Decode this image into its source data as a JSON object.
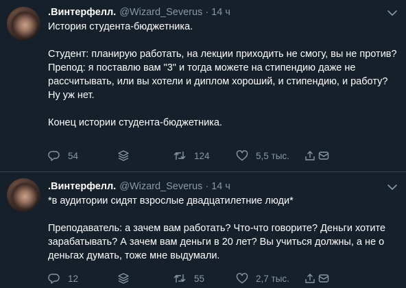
{
  "tweets": [
    {
      "author": {
        "name": ".Винтерфелл.",
        "handle": "@Wizard_Severus",
        "time": "14 ч",
        "separator": "·"
      },
      "paragraphs": [
        "История студента-бюджетника.",
        "",
        "Студент: планирую работать, на лекции приходить не смогу, вы не против?",
        "Препод: я поставлю вам \"3\" и тогда можете на стипендию даже не рассчитывать, или вы хотели и диплом хороший, и стипендию, и работу? Ну уж нет.",
        "",
        "Конец истории студента-бюджетника."
      ],
      "actions": {
        "replies": "54",
        "retweets": "124",
        "likes": "5,5 тыс."
      }
    },
    {
      "author": {
        "name": ".Винтерфелл.",
        "handle": "@Wizard_Severus",
        "time": "14 ч",
        "separator": "·"
      },
      "paragraphs": [
        "*в аудитории сидят взрослые двадцатилетние люди*",
        "",
        "Преподаватель: а зачем вам работать? Что-что говорите? Деньги хотите зарабатывать? А зачем вам деньги в 20 лет? Вы учиться должны, а не о деньгах думать, тоже мне выдумали."
      ],
      "actions": {
        "replies": "12",
        "retweets": "55",
        "likes": "2,7 тыс."
      }
    }
  ],
  "colors": {
    "background": "#15202b",
    "text": "#ffffff",
    "secondary": "#8899a6",
    "separator": "#38444d"
  },
  "icons": [
    "avatar",
    "chevron-down-icon",
    "reply-icon",
    "stack-icon",
    "retweet-icon",
    "like-icon",
    "share-icon",
    "message-icon"
  ]
}
